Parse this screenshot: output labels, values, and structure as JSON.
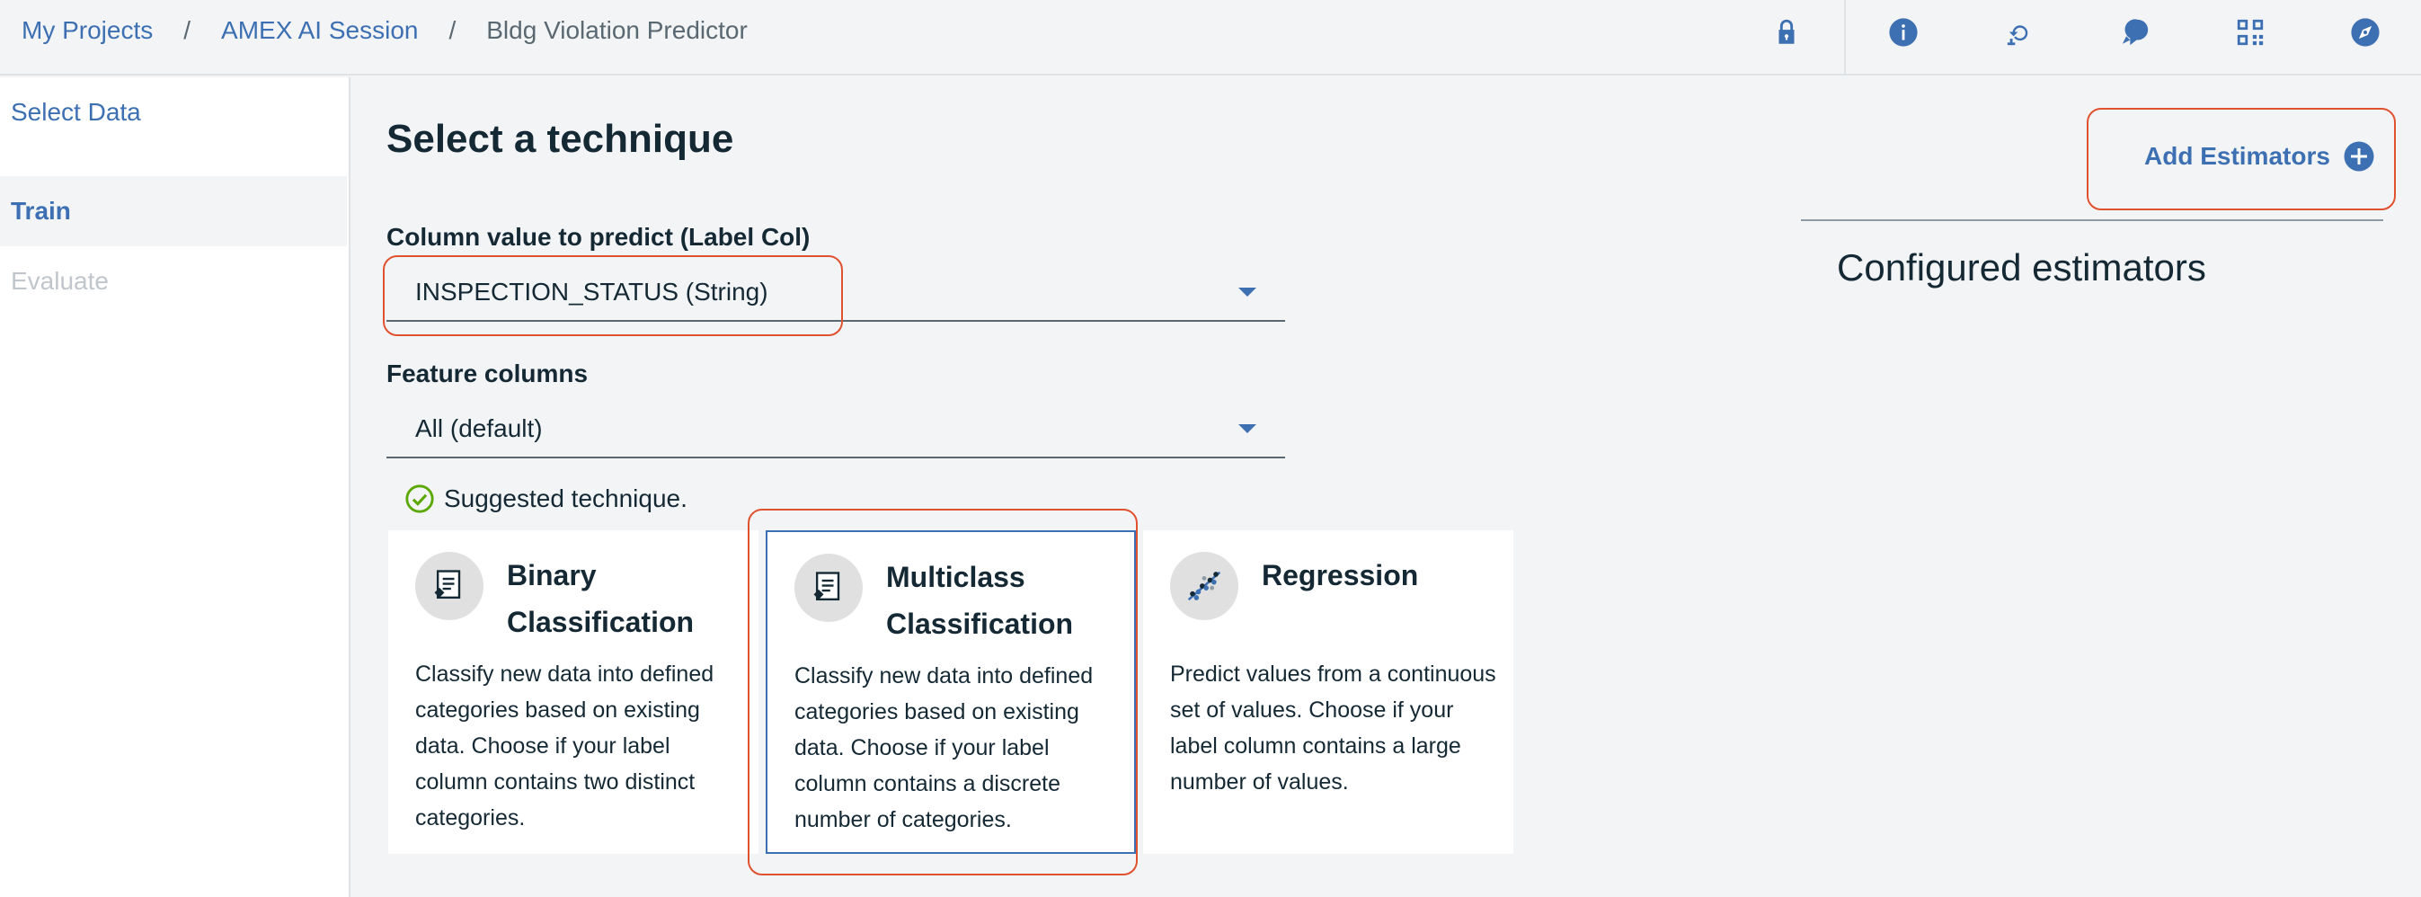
{
  "breadcrumb": {
    "items": [
      "My Projects",
      "AMEX AI Session",
      "Bldg Violation Predictor"
    ],
    "separator": "/"
  },
  "header_icons": [
    "lock-icon",
    "info-icon",
    "history-icon",
    "chat-icon",
    "grid-icon",
    "compass-icon"
  ],
  "sidebar": {
    "items": [
      {
        "label": "Select Data",
        "state": "link"
      },
      {
        "label": "Train",
        "state": "active"
      },
      {
        "label": "Evaluate",
        "state": "disabled"
      }
    ]
  },
  "main": {
    "title": "Select a technique",
    "label_col": {
      "label": "Column value to predict (Label Col)",
      "value": "INSPECTION_STATUS (String)"
    },
    "feature_cols": {
      "label": "Feature columns",
      "value": "All (default)"
    },
    "suggested_text": "Suggested technique.",
    "techniques": [
      {
        "title": "Binary Classification",
        "description": "Classify new data into defined categories based on existing data. Choose if your label column contains two distinct categories.",
        "icon": "tagged-document-icon",
        "selected": false
      },
      {
        "title": "Multiclass Classification",
        "description": "Classify new data into defined categories based on existing data. Choose if your label column contains a discrete number of categories.",
        "icon": "tagged-document-icon",
        "selected": true
      },
      {
        "title": "Regression",
        "description": "Predict values from a continuous set of values. Choose if your label column contains a large number of values.",
        "icon": "regression-dots-icon",
        "selected": false
      }
    ]
  },
  "right_panel": {
    "add_estimators_label": "Add Estimators",
    "configured_title": "Configured estimators"
  },
  "colors": {
    "accent": "#3d70b2",
    "highlight": "#e0522f",
    "success": "#5aa700"
  }
}
